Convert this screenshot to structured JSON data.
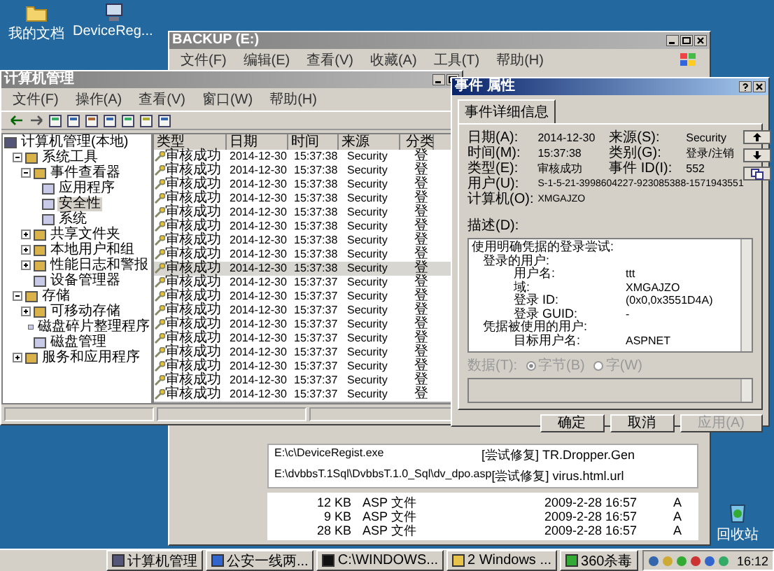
{
  "desktop_icons": [
    {
      "label": "我的文档"
    },
    {
      "label": "DeviceReg..."
    }
  ],
  "recycle_bin": {
    "label": "回收站"
  },
  "backup_window": {
    "title": "BACKUP (E:)",
    "menu": [
      "文件(F)",
      "编辑(E)",
      "查看(V)",
      "收藏(A)",
      "工具(T)",
      "帮助(H)"
    ],
    "scan_log": [
      {
        "path": "E:\\c\\DeviceRegist.exe",
        "result": "[尝试修复] TR.Dropper.Gen"
      },
      {
        "path": "E:\\dvbbsT.1Sql\\DvbbsT.1.0_Sql\\dv_dpo.asp",
        "result": "[尝试修复] virus.html.url"
      }
    ],
    "files": [
      {
        "size": "12 KB",
        "type": "ASP 文件",
        "date": "2009-2-28 16:57",
        "attr": "A"
      },
      {
        "size": "9 KB",
        "type": "ASP 文件",
        "date": "2009-2-28 16:57",
        "attr": "A"
      },
      {
        "size": "28 KB",
        "type": "ASP 文件",
        "date": "2009-2-28 16:57",
        "attr": "A"
      }
    ]
  },
  "computer_management": {
    "title": "计算机管理",
    "menu": [
      "文件(F)",
      "操作(A)",
      "查看(V)",
      "窗口(W)",
      "帮助(H)"
    ],
    "tree": [
      {
        "label": "计算机管理(本地)",
        "kind": "root",
        "selected": false,
        "children": [
          {
            "label": "系统工具",
            "kind": "folder",
            "expanded": true,
            "selected": false,
            "children": [
              {
                "label": "事件查看器",
                "kind": "folder",
                "expanded": true,
                "selected": false,
                "children": [
                  {
                    "label": "应用程序",
                    "kind": "leaf",
                    "selected": false
                  },
                  {
                    "label": "安全性",
                    "kind": "leaf",
                    "selected": true
                  },
                  {
                    "label": "系统",
                    "kind": "leaf",
                    "selected": false
                  }
                ]
              },
              {
                "label": "共享文件夹",
                "kind": "folder",
                "expanded": false,
                "selected": false
              },
              {
                "label": "本地用户和组",
                "kind": "folder",
                "expanded": false,
                "selected": false
              },
              {
                "label": "性能日志和警报",
                "kind": "folder",
                "expanded": false,
                "selected": false
              },
              {
                "label": "设备管理器",
                "kind": "leaf",
                "selected": false
              }
            ]
          },
          {
            "label": "存储",
            "kind": "folder",
            "expanded": true,
            "selected": false,
            "children": [
              {
                "label": "可移动存储",
                "kind": "folder",
                "expanded": false,
                "selected": false
              },
              {
                "label": "磁盘碎片整理程序",
                "kind": "leaf",
                "selected": false
              },
              {
                "label": "磁盘管理",
                "kind": "leaf",
                "selected": false
              }
            ]
          },
          {
            "label": "服务和应用程序",
            "kind": "folder",
            "expanded": false,
            "selected": false
          }
        ]
      }
    ],
    "columns": [
      "类型",
      "日期",
      "时间",
      "来源",
      "分类"
    ],
    "rows": [
      {
        "type": "审核成功",
        "date": "2014-12-30",
        "time": "15:37:38",
        "source": "Security",
        "category": "登",
        "selected": false
      },
      {
        "type": "审核成功",
        "date": "2014-12-30",
        "time": "15:37:38",
        "source": "Security",
        "category": "登",
        "selected": false
      },
      {
        "type": "审核成功",
        "date": "2014-12-30",
        "time": "15:37:38",
        "source": "Security",
        "category": "登",
        "selected": false
      },
      {
        "type": "审核成功",
        "date": "2014-12-30",
        "time": "15:37:38",
        "source": "Security",
        "category": "登",
        "selected": false
      },
      {
        "type": "审核成功",
        "date": "2014-12-30",
        "time": "15:37:38",
        "source": "Security",
        "category": "登",
        "selected": false
      },
      {
        "type": "审核成功",
        "date": "2014-12-30",
        "time": "15:37:38",
        "source": "Security",
        "category": "登",
        "selected": false
      },
      {
        "type": "审核成功",
        "date": "2014-12-30",
        "time": "15:37:38",
        "source": "Security",
        "category": "登",
        "selected": false
      },
      {
        "type": "审核成功",
        "date": "2014-12-30",
        "time": "15:37:38",
        "source": "Security",
        "category": "登",
        "selected": false
      },
      {
        "type": "审核成功",
        "date": "2014-12-30",
        "time": "15:37:38",
        "source": "Security",
        "category": "登",
        "selected": true
      },
      {
        "type": "审核成功",
        "date": "2014-12-30",
        "time": "15:37:37",
        "source": "Security",
        "category": "登",
        "selected": false
      },
      {
        "type": "审核成功",
        "date": "2014-12-30",
        "time": "15:37:37",
        "source": "Security",
        "category": "登",
        "selected": false
      },
      {
        "type": "审核成功",
        "date": "2014-12-30",
        "time": "15:37:37",
        "source": "Security",
        "category": "登",
        "selected": false
      },
      {
        "type": "审核成功",
        "date": "2014-12-30",
        "time": "15:37:37",
        "source": "Security",
        "category": "登",
        "selected": false
      },
      {
        "type": "审核成功",
        "date": "2014-12-30",
        "time": "15:37:37",
        "source": "Security",
        "category": "登",
        "selected": false
      },
      {
        "type": "审核成功",
        "date": "2014-12-30",
        "time": "15:37:37",
        "source": "Security",
        "category": "登",
        "selected": false
      },
      {
        "type": "审核成功",
        "date": "2014-12-30",
        "time": "15:37:37",
        "source": "Security",
        "category": "登",
        "selected": false
      },
      {
        "type": "审核成功",
        "date": "2014-12-30",
        "time": "15:37:37",
        "source": "Security",
        "category": "登",
        "selected": false
      },
      {
        "type": "审核成功",
        "date": "2014-12-30",
        "time": "15:37:37",
        "source": "Security",
        "category": "登",
        "selected": false
      }
    ]
  },
  "event_dialog": {
    "title": "事件 属性",
    "tab": "事件详细信息",
    "fields": [
      {
        "label": "日期(A):",
        "value": "2014-12-30"
      },
      {
        "label": "来源(S):",
        "value": "Security"
      },
      {
        "label": "时间(M):",
        "value": "15:37:38"
      },
      {
        "label": "类别(G):",
        "value": "登录/注销"
      },
      {
        "label": "类型(E):",
        "value": "审核成功"
      },
      {
        "label": "事件 ID(I):",
        "value": "552"
      },
      {
        "label": "用户(U):",
        "value": "S-1-5-21-3998604227-923085388-1571943551"
      },
      {
        "label": "计算机(O):",
        "value": "XMGAJZO"
      }
    ],
    "description_label": "描述(D):",
    "description": [
      {
        "text": "使用明确凭据的登录尝试:",
        "children": [
          {
            "text": "登录的用户:",
            "children": [
              {
                "label": "用户名:",
                "value": "ttt"
              },
              {
                "label": "域:",
                "value": "XMGAJZO"
              },
              {
                "label": "登录 ID:",
                "value": "(0x0,0x3551D4A)"
              },
              {
                "label": "登录 GUID:",
                "value": "-"
              }
            ]
          },
          {
            "text": "凭据被使用的用户:",
            "children": [
              {
                "label": "目标用户名:",
                "value": "ASPNET"
              }
            ]
          }
        ]
      }
    ],
    "data_label": "数据(T):",
    "data_format": [
      {
        "label": "字节(B)",
        "selected": true
      },
      {
        "label": "字(W)",
        "selected": false
      }
    ],
    "buttons": [
      {
        "label": "确定",
        "disabled": false
      },
      {
        "label": "取消",
        "disabled": false
      },
      {
        "label": "应用(A)",
        "disabled": true
      }
    ]
  },
  "taskbar": {
    "items": [
      {
        "label": "计算机管理",
        "kind": "mmc"
      },
      {
        "label": "公安一线两...",
        "kind": "ie"
      },
      {
        "label": "C:\\WINDOWS...",
        "kind": "cmd"
      },
      {
        "label": "2 Windows ...",
        "kind": "folder"
      },
      {
        "label": "360杀毒",
        "kind": "av"
      }
    ],
    "clock": "16:12"
  }
}
